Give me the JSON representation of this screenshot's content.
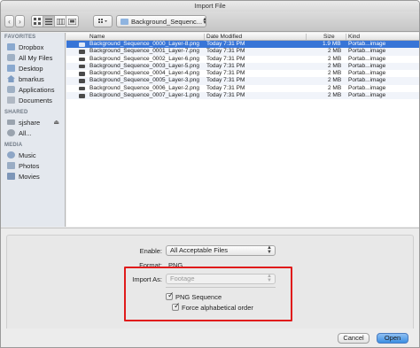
{
  "window": {
    "title": "Import File"
  },
  "toolbar": {
    "back_icon": "chevron-left-icon",
    "forward_icon": "chevron-right-icon",
    "view_modes": [
      "icon-view",
      "list-view",
      "column-view",
      "cover-flow-view"
    ],
    "arrange_icon": "arrange-grid-icon",
    "path_label": "Background_Sequenc..."
  },
  "sidebar": {
    "sections": [
      {
        "header": "FAVORITES",
        "items": [
          {
            "label": "Dropbox",
            "icon": "folder-icon"
          },
          {
            "label": "All My Files",
            "icon": "all-files-icon"
          },
          {
            "label": "Desktop",
            "icon": "desktop-icon"
          },
          {
            "label": "bmarkus",
            "icon": "home-icon"
          },
          {
            "label": "Applications",
            "icon": "applications-icon"
          },
          {
            "label": "Documents",
            "icon": "documents-icon"
          }
        ]
      },
      {
        "header": "SHARED",
        "items": [
          {
            "label": "sjshare",
            "icon": "server-icon"
          },
          {
            "label": "All...",
            "icon": "network-icon"
          }
        ]
      },
      {
        "header": "MEDIA",
        "items": [
          {
            "label": "Music",
            "icon": "music-icon"
          },
          {
            "label": "Photos",
            "icon": "photos-icon"
          },
          {
            "label": "Movies",
            "icon": "movies-icon"
          }
        ]
      }
    ]
  },
  "filelist": {
    "columns": {
      "name": "Name",
      "date": "Date Modified",
      "size": "Size",
      "kind": "Kind"
    },
    "rows": [
      {
        "name": "Background_Sequence_0000_Layer-8.png",
        "date": "Today 7:31 PM",
        "size": "1.9 MB",
        "kind": "Portab...image",
        "selected": true
      },
      {
        "name": "Background_Sequence_0001_Layer-7.png",
        "date": "Today 7:31 PM",
        "size": "2 MB",
        "kind": "Portab...image",
        "selected": false
      },
      {
        "name": "Background_Sequence_0002_Layer-6.png",
        "date": "Today 7:31 PM",
        "size": "2 MB",
        "kind": "Portab...image",
        "selected": false
      },
      {
        "name": "Background_Sequence_0003_Layer-5.png",
        "date": "Today 7:31 PM",
        "size": "2 MB",
        "kind": "Portab...image",
        "selected": false
      },
      {
        "name": "Background_Sequence_0004_Layer-4.png",
        "date": "Today 7:31 PM",
        "size": "2 MB",
        "kind": "Portab...image",
        "selected": false
      },
      {
        "name": "Background_Sequence_0005_Layer-3.png",
        "date": "Today 7:31 PM",
        "size": "2 MB",
        "kind": "Portab...image",
        "selected": false
      },
      {
        "name": "Background_Sequence_0006_Layer-2.png",
        "date": "Today 7:31 PM",
        "size": "2 MB",
        "kind": "Portab...image",
        "selected": false
      },
      {
        "name": "Background_Sequence_0007_Layer-1.png",
        "date": "Today 7:31 PM",
        "size": "2 MB",
        "kind": "Portab...image",
        "selected": false
      }
    ]
  },
  "options": {
    "enable_label": "Enable:",
    "enable_value": "All Acceptable Files",
    "format_label": "Format:",
    "format_value": "PNG",
    "import_as_label": "Import As:",
    "import_as_value": "Footage",
    "png_sequence_label": "PNG Sequence",
    "png_sequence_checked": true,
    "force_alpha_label": "Force alphabetical order",
    "force_alpha_checked": true
  },
  "buttons": {
    "cancel": "Cancel",
    "open": "Open"
  },
  "colors": {
    "selection": "#3875d7",
    "highlight_box": "#e01b1b",
    "default_button": "#3c8fe3"
  }
}
